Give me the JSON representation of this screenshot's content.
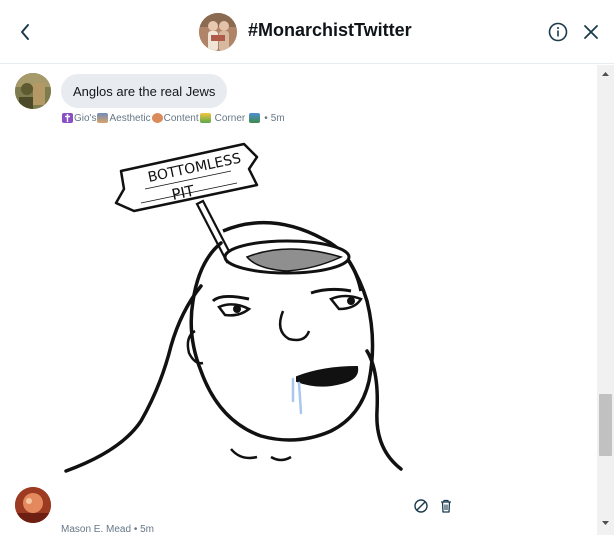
{
  "header": {
    "title": "#MonarchistTwitter"
  },
  "messages": [
    {
      "text": "Anglos are the real Jews",
      "meta": {
        "name_parts": [
          "Gio's",
          "Aesthetic",
          "Content",
          "Corner"
        ],
        "separator": "•",
        "time": "5m"
      },
      "image": {
        "sign_line1": "BOTTOMLESS",
        "sign_line2": "PIT"
      }
    },
    {
      "meta": {
        "author": "Mason E. Mead",
        "separator": "•",
        "time": "5m"
      }
    }
  ],
  "icons": {
    "back": "chevron-left-icon",
    "info": "info-icon",
    "close": "close-icon",
    "block": "block-icon",
    "delete": "trash-icon"
  },
  "colors": {
    "bubble": "#e8ecf1",
    "meta_text": "#657786",
    "icon": "#1a3b4d",
    "divider": "#e6ecf0"
  }
}
